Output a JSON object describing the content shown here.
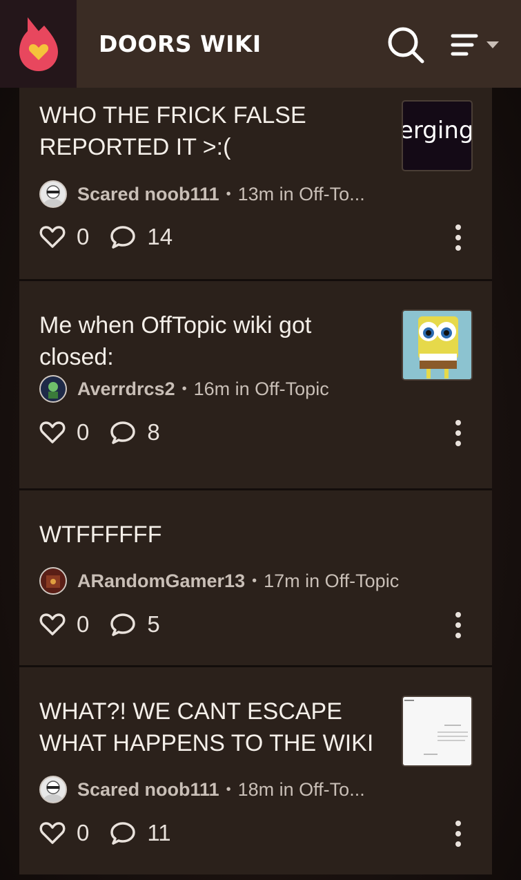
{
  "header": {
    "title": "DOORS WIKI",
    "logo_icon": "fandom-flame-heart-icon",
    "search_icon": "search-icon",
    "menu_icon": "menu-lines-dropdown-icon"
  },
  "colors": {
    "header_bg": "#3a2c24",
    "card_bg": "#2b211b",
    "logo_flame": "#e8475e",
    "logo_heart": "#f5c33b"
  },
  "posts": [
    {
      "title": "WHO THE FRICK FALSE REPORTED IT >:(",
      "thumbnail_text": "erging",
      "author": "Scared noob111",
      "meta": "13m in Off-To...",
      "likes": "0",
      "comments": "14"
    },
    {
      "title": "Me when OffTopic wiki got closed:",
      "author": "Averrdrcs2",
      "meta": "16m in Off-Topic",
      "likes": "0",
      "comments": "8"
    },
    {
      "title": "WTFFFFFF",
      "author": "ARandomGamer13",
      "meta": "17m in Off-Topic",
      "likes": "0",
      "comments": "5"
    },
    {
      "title": "WHAT?! WE CANT ESCAPE WHAT HAPPENS TO THE WIKI",
      "author": "Scared noob111",
      "meta": "18m in Off-To...",
      "likes": "0",
      "comments": "11"
    }
  ]
}
